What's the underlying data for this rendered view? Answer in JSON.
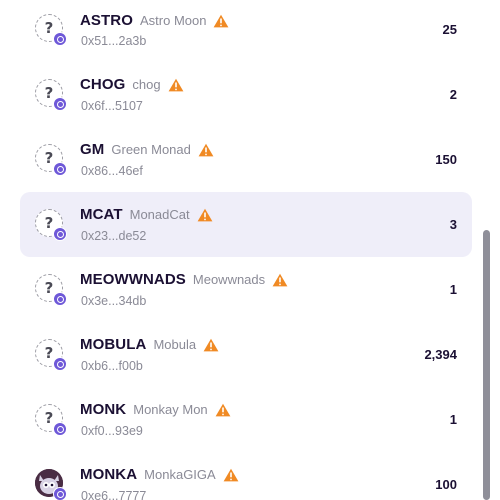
{
  "tokens": [
    {
      "symbol": "ASTRO",
      "name": "Astro Moon",
      "address": "0x51...2a3b",
      "balance": "25",
      "icon": "unknown-token-icon",
      "selected": false
    },
    {
      "symbol": "CHOG",
      "name": "chog",
      "address": "0x6f...5107",
      "balance": "2",
      "icon": "unknown-token-icon",
      "selected": false
    },
    {
      "symbol": "GM",
      "name": "Green Monad",
      "address": "0x86...46ef",
      "balance": "150",
      "icon": "unknown-token-icon",
      "selected": false
    },
    {
      "symbol": "MCAT",
      "name": "MonadCat",
      "address": "0x23...de52",
      "balance": "3",
      "icon": "unknown-token-icon",
      "selected": true
    },
    {
      "symbol": "MEOWWNADS",
      "name": "Meowwnads",
      "address": "0x3e...34db",
      "balance": "1",
      "icon": "unknown-token-icon",
      "selected": false
    },
    {
      "symbol": "MOBULA",
      "name": "Mobula",
      "address": "0xb6...f00b",
      "balance": "2,394",
      "icon": "unknown-token-icon",
      "selected": false
    },
    {
      "symbol": "MONK",
      "name": "Monkay Mon",
      "address": "0xf0...93e9",
      "balance": "1",
      "icon": "unknown-token-icon",
      "selected": false
    },
    {
      "symbol": "MONKA",
      "name": "MonkaGIGA",
      "address": "0xe6...7777",
      "balance": "100",
      "icon": "monka-token-icon",
      "selected": false
    }
  ],
  "colors": {
    "warning": "#f08a24",
    "chain_badge": "#6e58d8",
    "selected_row": "#efeef9",
    "symbol_text": "#1b1033",
    "muted_text": "#8a8a96"
  }
}
